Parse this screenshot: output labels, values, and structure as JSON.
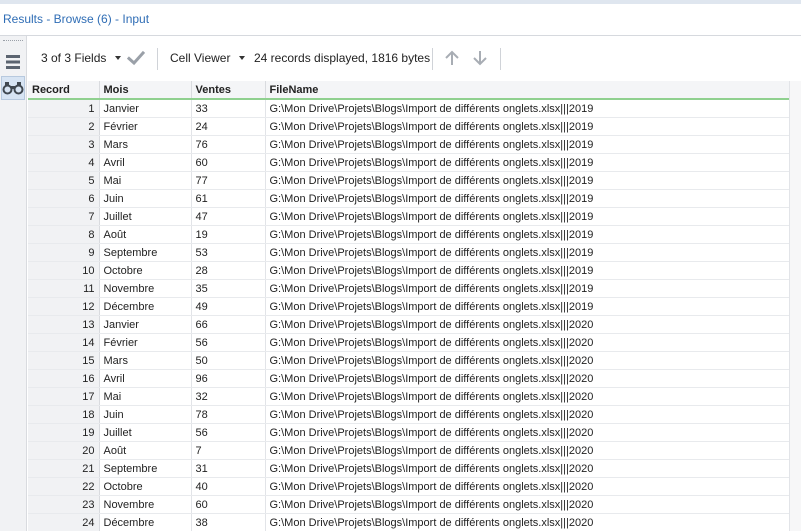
{
  "window": {
    "title": "Results - Browse (6) - Input"
  },
  "left_panel": {
    "grip_icon": "grip-dots-icon",
    "view_icon": "rows-view-icon",
    "browse_icon": "binoculars-icon"
  },
  "toolbar": {
    "fields_label": "3 of 3 Fields",
    "apply_icon": "check-icon",
    "viewer_label": "Cell Viewer",
    "records_info": "24 records displayed, 1816 bytes",
    "up_icon": "arrow-up-icon",
    "down_icon": "arrow-down-icon"
  },
  "table": {
    "columns": [
      "Record",
      "Mois",
      "Ventes",
      "FileName"
    ],
    "rows": [
      [
        "1",
        "Janvier",
        "33",
        "G:\\Mon Drive\\Projets\\Blogs\\Import de différents onglets.xlsx|||2019"
      ],
      [
        "2",
        "Février",
        "24",
        "G:\\Mon Drive\\Projets\\Blogs\\Import de différents onglets.xlsx|||2019"
      ],
      [
        "3",
        "Mars",
        "76",
        "G:\\Mon Drive\\Projets\\Blogs\\Import de différents onglets.xlsx|||2019"
      ],
      [
        "4",
        "Avril",
        "60",
        "G:\\Mon Drive\\Projets\\Blogs\\Import de différents onglets.xlsx|||2019"
      ],
      [
        "5",
        "Mai",
        "77",
        "G:\\Mon Drive\\Projets\\Blogs\\Import de différents onglets.xlsx|||2019"
      ],
      [
        "6",
        "Juin",
        "61",
        "G:\\Mon Drive\\Projets\\Blogs\\Import de différents onglets.xlsx|||2019"
      ],
      [
        "7",
        "Juillet",
        "47",
        "G:\\Mon Drive\\Projets\\Blogs\\Import de différents onglets.xlsx|||2019"
      ],
      [
        "8",
        "Août",
        "19",
        "G:\\Mon Drive\\Projets\\Blogs\\Import de différents onglets.xlsx|||2019"
      ],
      [
        "9",
        "Septembre",
        "53",
        "G:\\Mon Drive\\Projets\\Blogs\\Import de différents onglets.xlsx|||2019"
      ],
      [
        "10",
        "Octobre",
        "28",
        "G:\\Mon Drive\\Projets\\Blogs\\Import de différents onglets.xlsx|||2019"
      ],
      [
        "11",
        "Novembre",
        "35",
        "G:\\Mon Drive\\Projets\\Blogs\\Import de différents onglets.xlsx|||2019"
      ],
      [
        "12",
        "Décembre",
        "49",
        "G:\\Mon Drive\\Projets\\Blogs\\Import de différents onglets.xlsx|||2019"
      ],
      [
        "13",
        "Janvier",
        "66",
        "G:\\Mon Drive\\Projets\\Blogs\\Import de différents onglets.xlsx|||2020"
      ],
      [
        "14",
        "Février",
        "56",
        "G:\\Mon Drive\\Projets\\Blogs\\Import de différents onglets.xlsx|||2020"
      ],
      [
        "15",
        "Mars",
        "50",
        "G:\\Mon Drive\\Projets\\Blogs\\Import de différents onglets.xlsx|||2020"
      ],
      [
        "16",
        "Avril",
        "96",
        "G:\\Mon Drive\\Projets\\Blogs\\Import de différents onglets.xlsx|||2020"
      ],
      [
        "17",
        "Mai",
        "32",
        "G:\\Mon Drive\\Projets\\Blogs\\Import de différents onglets.xlsx|||2020"
      ],
      [
        "18",
        "Juin",
        "78",
        "G:\\Mon Drive\\Projets\\Blogs\\Import de différents onglets.xlsx|||2020"
      ],
      [
        "19",
        "Juillet",
        "56",
        "G:\\Mon Drive\\Projets\\Blogs\\Import de différents onglets.xlsx|||2020"
      ],
      [
        "20",
        "Août",
        "7",
        "G:\\Mon Drive\\Projets\\Blogs\\Import de différents onglets.xlsx|||2020"
      ],
      [
        "21",
        "Septembre",
        "31",
        "G:\\Mon Drive\\Projets\\Blogs\\Import de différents onglets.xlsx|||2020"
      ],
      [
        "22",
        "Octobre",
        "40",
        "G:\\Mon Drive\\Projets\\Blogs\\Import de différents onglets.xlsx|||2020"
      ],
      [
        "23",
        "Novembre",
        "60",
        "G:\\Mon Drive\\Projets\\Blogs\\Import de différents onglets.xlsx|||2020"
      ],
      [
        "24",
        "Décembre",
        "38",
        "G:\\Mon Drive\\Projets\\Blogs\\Import de différents onglets.xlsx|||2020"
      ]
    ]
  },
  "colors": {
    "title": "#2f6db5",
    "header_underline": "#8fd08f",
    "active_button": "#d7e4f3"
  }
}
